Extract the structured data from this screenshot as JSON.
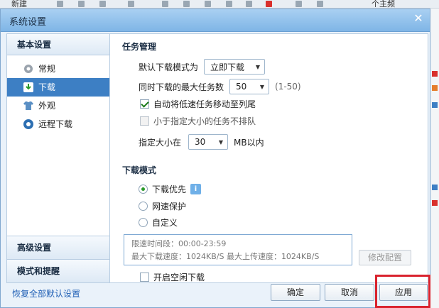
{
  "background": {
    "toolbar_new": "新建",
    "toolbar_right": "个主频"
  },
  "dialog": {
    "title": "系统设置",
    "close_glyph": "✕"
  },
  "sidebar": {
    "group_basic": "基本设置",
    "items": [
      {
        "label": "常规",
        "icon": "gear-icon",
        "active": false
      },
      {
        "label": "下载",
        "icon": "download-icon",
        "active": true
      },
      {
        "label": "外观",
        "icon": "shirt-icon",
        "active": false
      },
      {
        "label": "远程下载",
        "icon": "remote-download-icon",
        "active": false
      }
    ],
    "group_advanced": "高级设置",
    "group_mode": "模式和提醒"
  },
  "task": {
    "title": "任务管理",
    "default_mode_label": "默认下载模式为",
    "default_mode_value": "立即下载",
    "max_tasks_label": "同时下载的最大任务数",
    "max_tasks_value": "50",
    "max_tasks_hint": "(1-50)",
    "auto_move_label": "自动将低速任务移动至列尾",
    "auto_move_checked": true,
    "no_queue_label": "小于指定大小的任务不排队",
    "no_queue_checked": false,
    "size_label": "指定大小在",
    "size_value": "30",
    "size_unit": "MB以内"
  },
  "download_mode": {
    "title": "下载模式",
    "options": [
      {
        "label": "下载优先",
        "selected": true
      },
      {
        "label": "网速保护",
        "selected": false
      },
      {
        "label": "自定义",
        "selected": false
      }
    ],
    "info_icon": "i",
    "limit_period": "限速时间段：00:00-23:59",
    "limit_speeds": "最大下载速度：1024KB/S  最大上传速度：1024KB/S",
    "modify_label": "修改配置",
    "idle_label": "开启空闲下载",
    "idle_checked": false
  },
  "footer": {
    "restore_label": "恢复全部默认设置",
    "ok_label": "确定",
    "cancel_label": "取消",
    "apply_label": "应用"
  },
  "colors": {
    "accent": "#3d7fc4",
    "highlight": "#d9232e"
  }
}
